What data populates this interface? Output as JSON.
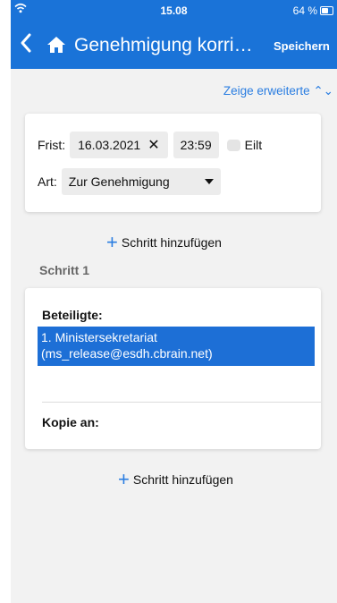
{
  "status_bar": {
    "time": "15.08",
    "battery": "64 %",
    "battery_level": 0.64,
    "icons": [
      "wifi-icon",
      "battery-icon"
    ]
  },
  "nav": {
    "title": "Genehmigung korrigieren",
    "save_label": "Speichern",
    "icons": [
      "back-chevron-icon",
      "home-icon"
    ]
  },
  "advanced_toggle": "Zeige erweiterte ⌃⌄",
  "deadline": {
    "label": "Frist:",
    "date": "16.03.2021",
    "clear_symbol": "✕",
    "time": "23:59",
    "urgent_label": "Eilt",
    "urgent_checked": false
  },
  "kind": {
    "label": "Art:",
    "value": "Zur Genehmigung"
  },
  "add_step_label": "Schritt hinzufügen",
  "add_step_label_2": "Schritt hinzufügen",
  "add_step_symbol": "+",
  "step": {
    "title": "Schritt 1",
    "participants_label": "Beteiligte:",
    "participant_line1": "1. Ministersekretariat",
    "participant_line2": "(ms_release@esdh.cbrain.net)",
    "copy_to_label": "Kopie an:"
  },
  "colors": {
    "primary": "#1a73d8",
    "selection": "#1d6fd6",
    "accent_text": "#2a7de1",
    "background": "#f2f2f2"
  }
}
